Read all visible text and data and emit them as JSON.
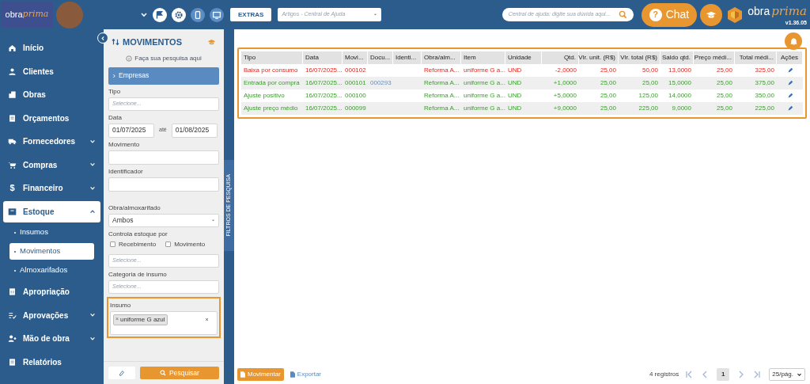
{
  "header": {
    "logo": {
      "part_1": "obra",
      "part_2": "prima"
    },
    "extras_button": "EXTRAS",
    "help_select": {
      "placeholder": "Artigos - Central de Ajuda"
    },
    "help_search": {
      "placeholder": "Central de ajuda: digite sua dúvida aqui..."
    },
    "chat_icon": "?",
    "chat_button": "Chat",
    "brand": {
      "part_1": "obra",
      "part_2": "prima"
    },
    "version": "v1.36.05"
  },
  "sidebar": {
    "items": [
      {
        "label": "Início",
        "expandable": false,
        "expanded": false
      },
      {
        "label": "Clientes",
        "expandable": false,
        "expanded": false
      },
      {
        "label": "Obras",
        "expandable": false,
        "expanded": false
      },
      {
        "label": "Orçamentos",
        "expandable": false,
        "expanded": false
      },
      {
        "label": "Fornecedores",
        "expandable": true,
        "expanded": false
      },
      {
        "label": "Compras",
        "expandable": true,
        "expanded": false
      },
      {
        "label": "Financeiro",
        "icon_text": "$",
        "expandable": true,
        "expanded": false
      },
      {
        "label": "Estoque",
        "expandable": true,
        "expanded": true,
        "children": [
          {
            "label": "Insumos",
            "selected": false
          },
          {
            "label": "Movimentos",
            "selected": true
          },
          {
            "label": "Almoxarifados",
            "selected": false
          }
        ]
      },
      {
        "label": "Apropriação",
        "expandable": false,
        "expanded": false
      },
      {
        "label": "Aprovações",
        "expandable": true,
        "expanded": false
      },
      {
        "label": "Mão de obra",
        "expandable": true,
        "expanded": false
      },
      {
        "label": "Relatórios",
        "expandable": false,
        "expanded": false
      }
    ]
  },
  "filters": {
    "title": "MOVIMENTOS",
    "hint": "Faça sua pesquisa aqui",
    "section": "Empresas",
    "fields": [
      {
        "kind": "select",
        "label": "Tipo",
        "placeholder": "Selecione..."
      },
      {
        "kind": "daterange",
        "label": "Data",
        "from": "01/07/2025",
        "separator": "até",
        "to": "01/08/2025"
      },
      {
        "kind": "text",
        "label": "Movimento"
      },
      {
        "kind": "text",
        "label": "Identificador"
      },
      {
        "kind": "dropdown",
        "label": "Obra/almoxarifado",
        "value": "Ambos"
      },
      {
        "kind": "checkgroup",
        "label": "Controla estoque por",
        "options": [
          {
            "label": "Recebimento",
            "checked": false
          },
          {
            "label": "Movimento",
            "checked": false
          }
        ]
      },
      {
        "kind": "select",
        "placeholder": "Selecione..."
      },
      {
        "kind": "select",
        "label": "Categoria de insumo",
        "placeholder": "Selecione..."
      },
      {
        "kind": "tags",
        "label": "Insumo",
        "tags": [
          {
            "remove": "×",
            "label": "uniforme G azul"
          }
        ],
        "highlighted": true
      }
    ],
    "search_button": "Pesquisar",
    "side_tab": "FILTROS DE PESQUISA"
  },
  "table": {
    "columns": [
      "Tipo",
      "Data",
      "Movi...",
      "Docu...",
      "Identi...",
      "Obra/alm...",
      "Item",
      "Unidade",
      "Qtd.",
      "Vlr. unit. (R$)",
      "Vlr. total (R$)",
      "Saldo qtd.",
      "Preço médi...",
      "Total médi...",
      "Ações"
    ],
    "rows": [
      {
        "kind": "exit",
        "cells": [
          "Baixa por consumo",
          "16/07/2025...",
          "000102",
          "",
          "",
          "Reforma A...",
          "uniforme G a...",
          "UND",
          "-2,0000",
          "25,00",
          "50,00",
          "13,0000",
          "25,00",
          "325,00"
        ]
      },
      {
        "kind": "entry",
        "cells": [
          "Entrada por compra",
          "16/07/2025...",
          "000101",
          "000293",
          "",
          "Reforma A...",
          "uniforme G a...",
          "UND",
          "+1,0000",
          "25,00",
          "25,00",
          "15,0000",
          "25,00",
          "375,00"
        ]
      },
      {
        "kind": "entry",
        "cells": [
          "Ajuste positivo",
          "16/07/2025...",
          "000100",
          "",
          "",
          "Reforma A...",
          "uniforme G a...",
          "UND",
          "+5,0000",
          "25,00",
          "125,00",
          "14,0000",
          "25,00",
          "350,00"
        ]
      },
      {
        "kind": "entry",
        "cells": [
          "Ajuste preço médio",
          "16/07/2025...",
          "000099",
          "",
          "",
          "Reforma A...",
          "uniforme G a...",
          "UND",
          "+9,0000",
          "25,00",
          "225,00",
          "9,0000",
          "25,00",
          "225,00"
        ]
      }
    ],
    "highlighted": true
  },
  "footer": {
    "actions": [
      "Movimentar",
      "Exportar"
    ],
    "count": "4 registros",
    "page": "1",
    "page_size": "25/pág."
  }
}
